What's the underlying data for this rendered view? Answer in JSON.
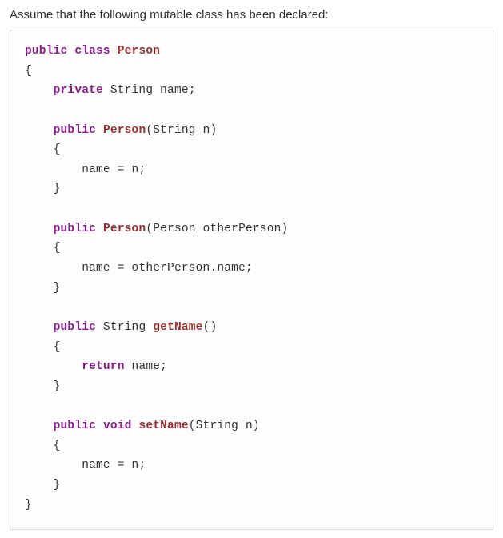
{
  "intro": "Assume that the following mutable class has been declared:",
  "kw": {
    "public": "public",
    "class": "class",
    "private": "private",
    "return": "return",
    "void": "void"
  },
  "cls": "Person",
  "types": {
    "String": "String",
    "PersonType": "Person"
  },
  "ids": {
    "name": "name",
    "n": "n",
    "otherPerson": "otherPerson"
  },
  "mth": {
    "Person": "Person",
    "getName": "getName",
    "setName": "setName"
  },
  "sym": {
    "obrace": "{",
    "cbrace": "}",
    "oparen": "(",
    "cparen": ")",
    "semi": ";",
    "eq": " = ",
    "dot": ".",
    "sp": " ",
    "empty_parens": "()"
  }
}
